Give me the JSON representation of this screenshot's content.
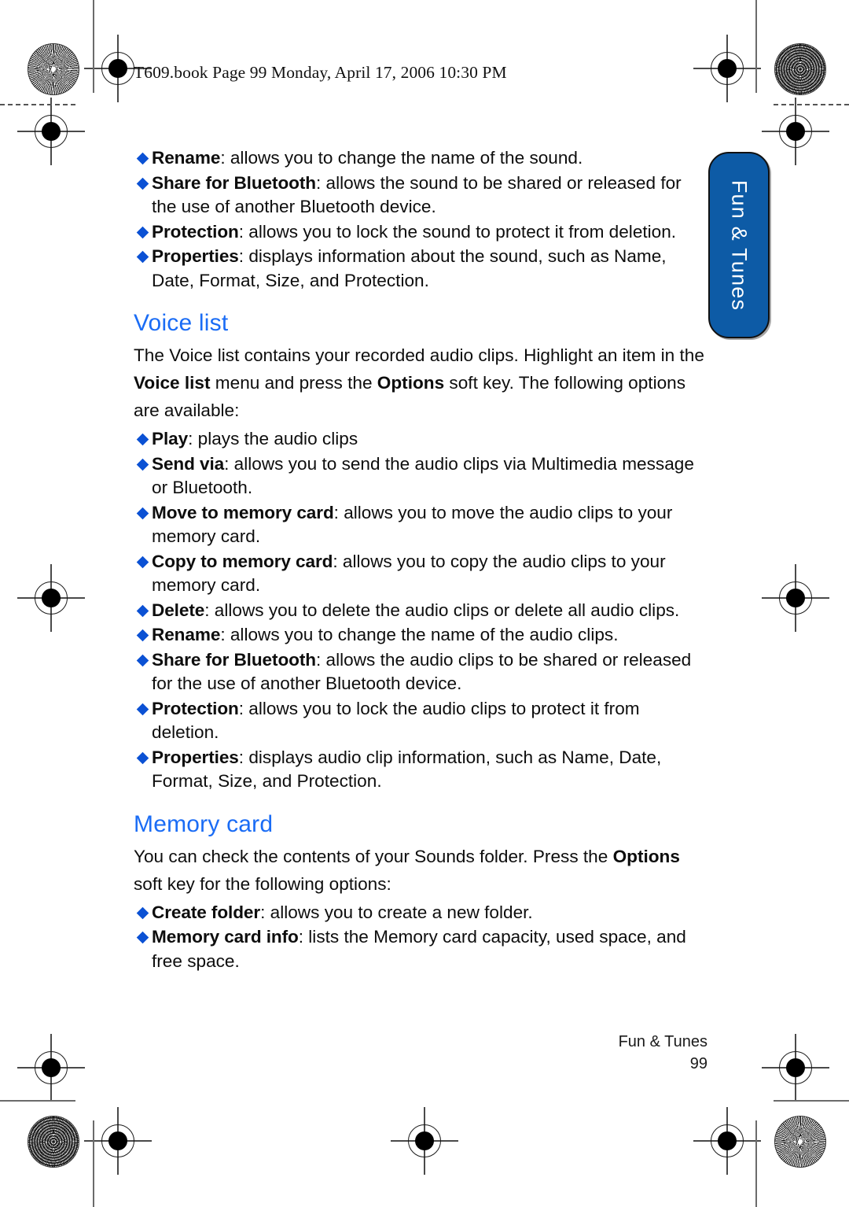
{
  "header": {
    "running_text": "T609.book  Page 99  Monday, April 17, 2006  10:30 PM"
  },
  "side_tab": {
    "label": "Fun & Tunes",
    "background_color": "#0d5ba6",
    "text_color": "#ffffff"
  },
  "colors": {
    "heading_blue": "#1a6cf5",
    "bullet_blue": "#0b51d4",
    "body_black": "#0d0d0d"
  },
  "content": {
    "intro_bullets": [
      {
        "term": "Rename",
        "text": ": allows you to change the name of the sound."
      },
      {
        "term": "Share for Bluetooth",
        "text": ": allows the sound to be shared or released for the use of another Bluetooth device."
      },
      {
        "term": "Protection",
        "text": ": allows you to lock the sound to protect it from deletion."
      },
      {
        "term": "Properties",
        "text": ": displays information about the sound, such as Name, Date, Format, Size, and Protection."
      }
    ],
    "sections": [
      {
        "heading": "Voice list",
        "paragraph_runs": [
          {
            "text": "The Voice list contains your recorded audio clips. Highlight an item in the ",
            "bold": false
          },
          {
            "text": "Voice list",
            "bold": true
          },
          {
            "text": " menu and press the ",
            "bold": false
          },
          {
            "text": "Options",
            "bold": true
          },
          {
            "text": " soft key. The following options are available:",
            "bold": false
          }
        ],
        "bullets": [
          {
            "term": "Play",
            "text": ": plays the audio clips"
          },
          {
            "term": "Send via",
            "text": ": allows you to send the audio clips via Multimedia message or Bluetooth."
          },
          {
            "term": "Move to memory card",
            "text": ": allows you to move the audio clips to your memory card."
          },
          {
            "term": "Copy to memory card",
            "text": ": allows you to copy the audio clips to your memory card."
          },
          {
            "term": "Delete",
            "text": ": allows you to delete the audio clips or delete all audio clips."
          },
          {
            "term": "Rename",
            "text": ": allows you to change the name of the audio clips."
          },
          {
            "term": "Share for Bluetooth",
            "text": ": allows the audio clips to be shared or released for the use of another Bluetooth device."
          },
          {
            "term": "Protection",
            "text": ": allows you to lock the audio clips to protect it from deletion."
          },
          {
            "term": "Properties",
            "text": ": displays audio clip information, such as Name, Date, Format, Size, and Protection."
          }
        ]
      },
      {
        "heading": "Memory card",
        "paragraph_runs": [
          {
            "text": "You can check the contents of your Sounds folder. Press the ",
            "bold": false
          },
          {
            "text": "Options",
            "bold": true
          },
          {
            "text": " soft key for the following options:",
            "bold": false
          }
        ],
        "bullets": [
          {
            "term": "Create folder",
            "text": ": allows you to create a new folder."
          },
          {
            "term": "Memory card info",
            "text": ": lists the Memory card capacity, used space, and free space."
          }
        ]
      }
    ]
  },
  "footer": {
    "chapter": "Fun & Tunes",
    "page_number": "99"
  }
}
